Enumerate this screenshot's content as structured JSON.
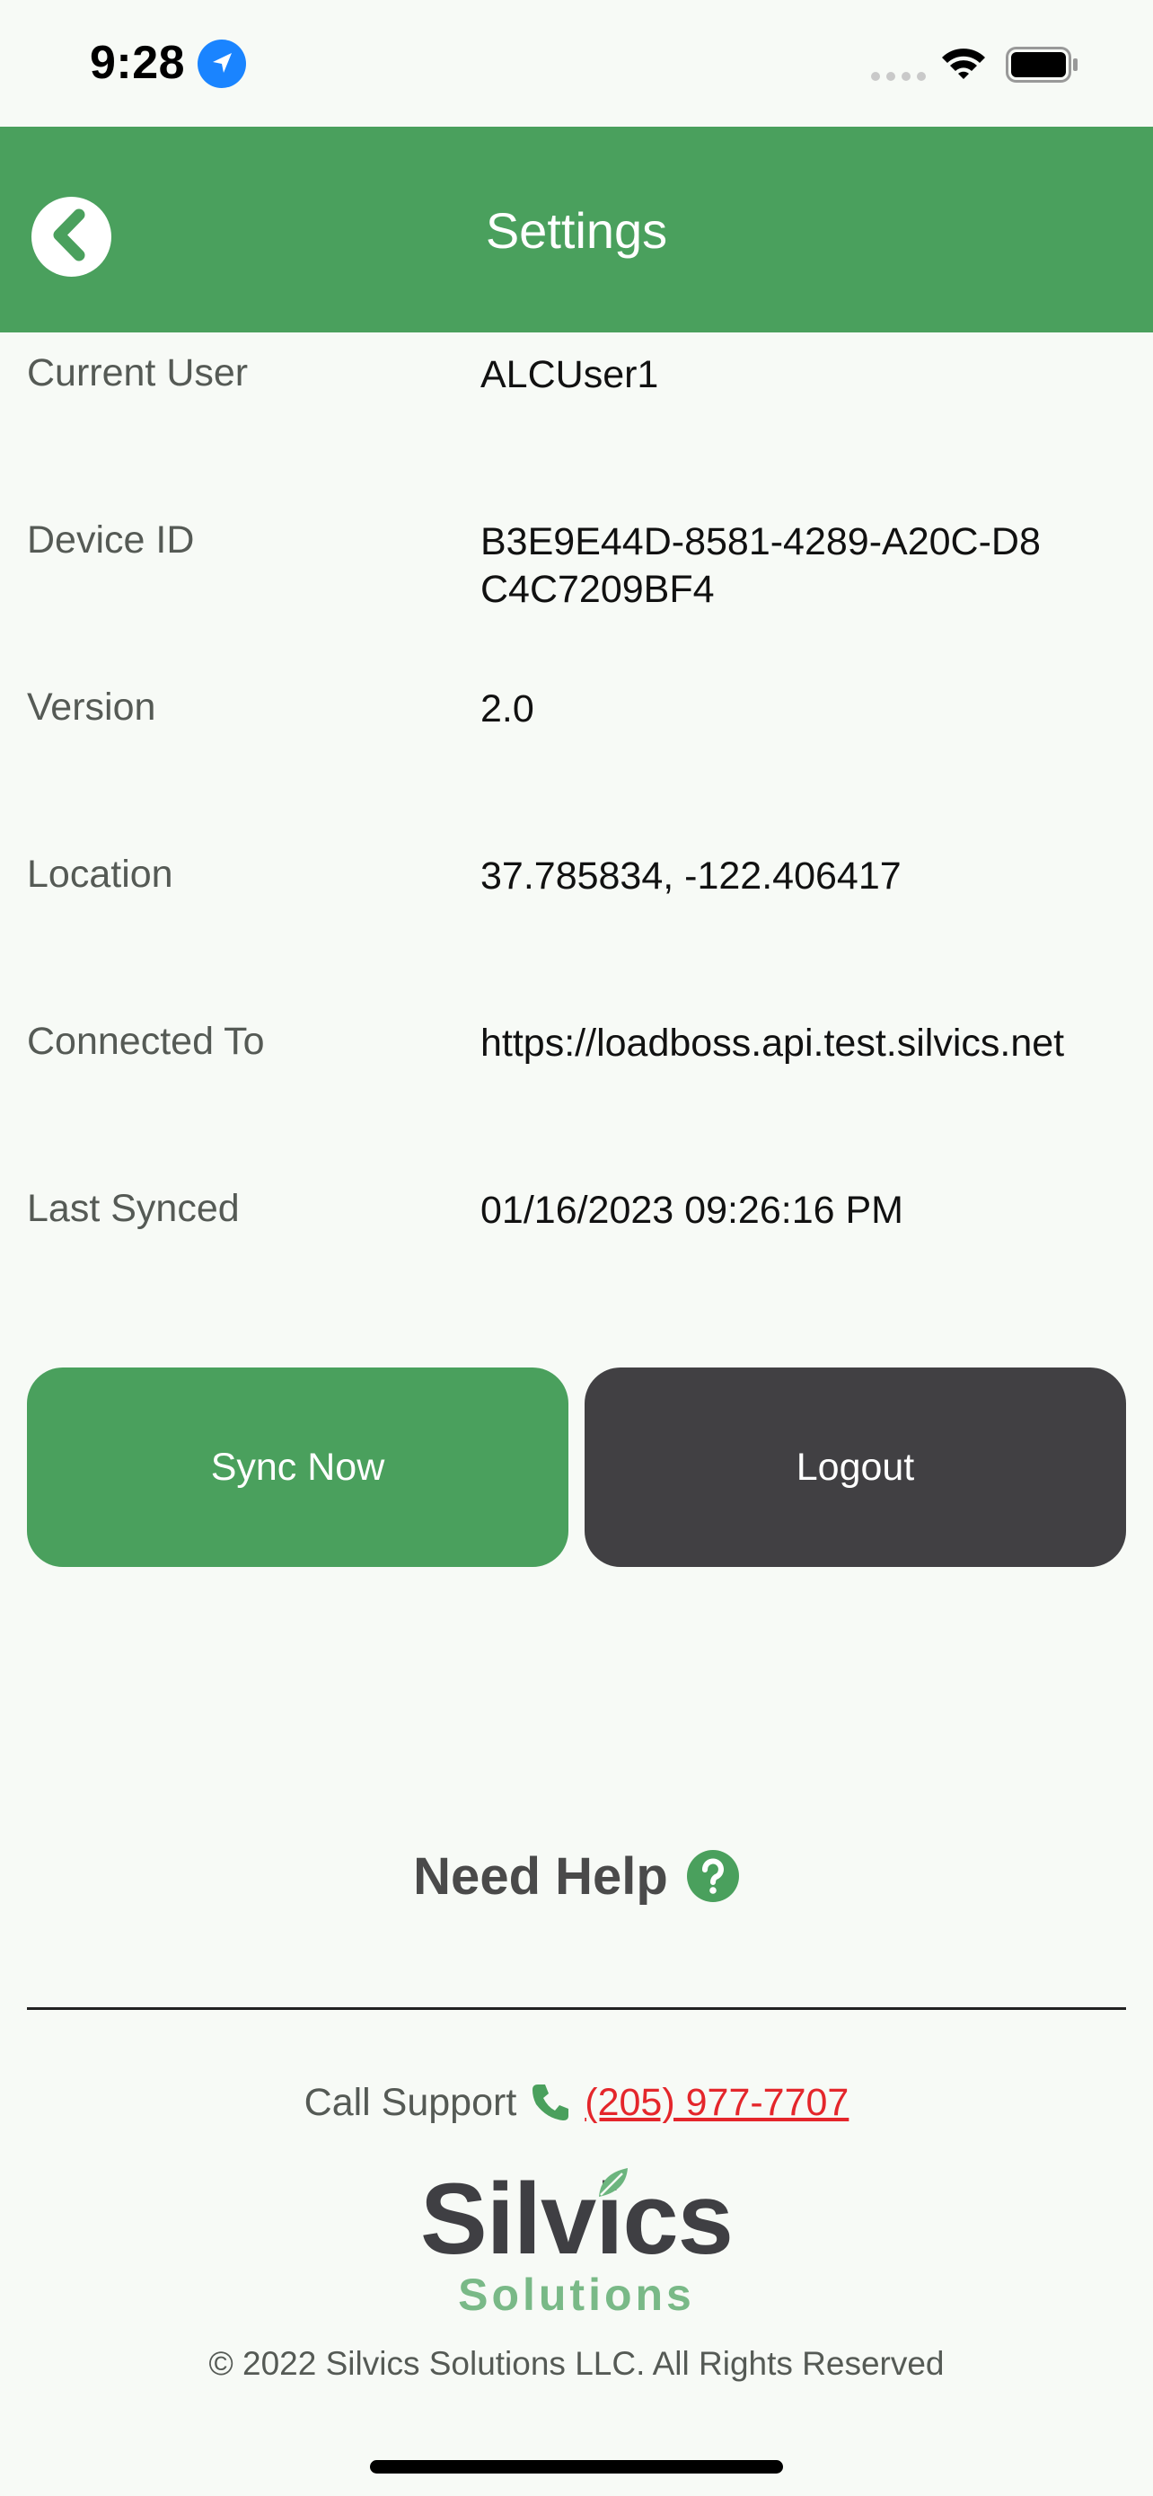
{
  "status_bar": {
    "time": "9:28",
    "icons": [
      "location-arrow-icon",
      "signal-icon",
      "wifi-icon",
      "battery-icon"
    ]
  },
  "header": {
    "title": "Settings",
    "back_icon": "chevron-left-icon",
    "background_color": "#4aa05d"
  },
  "info": [
    {
      "label": "Current User",
      "value": "ALCUser1"
    },
    {
      "label": "Device ID",
      "value": "B3E9E44D-8581-4289-A20C-D8C4C7209BF4"
    },
    {
      "label": "Version",
      "value": "2.0"
    },
    {
      "label": "Location",
      "value": "37.785834, -122.406417"
    },
    {
      "label": "Connected To",
      "value": "https://loadboss.api.test.silvics.net"
    },
    {
      "label": "Last Synced",
      "value": "01/16/2023 09:26:16 PM"
    }
  ],
  "buttons": {
    "sync_label": "Sync Now",
    "logout_label": "Logout",
    "sync_color": "#4aa05d",
    "logout_color": "#414043"
  },
  "help": {
    "title": "Need Help",
    "icon": "question-circle-icon"
  },
  "support": {
    "label": "Call Support",
    "phone_icon": "phone-icon",
    "phone": "(205) 977-7707",
    "phone_color": "#e4262b"
  },
  "logo": {
    "primary": "Silvics",
    "secondary": "Solutions"
  },
  "copyright": "© 2022 Silvics Solutions LLC. All Rights Reserved"
}
